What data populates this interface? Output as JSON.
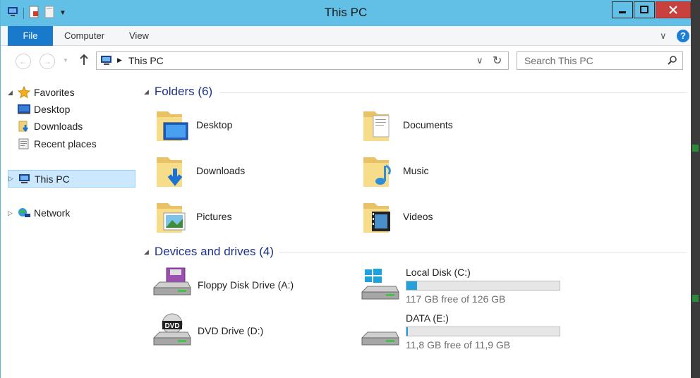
{
  "window": {
    "title": "This PC"
  },
  "ribbon": {
    "tabs": [
      "File",
      "Computer",
      "View"
    ]
  },
  "address": {
    "crumb": "This PC",
    "search_placeholder": "Search This PC"
  },
  "nav": {
    "favorites": "Favorites",
    "desktop": "Desktop",
    "downloads": "Downloads",
    "recent": "Recent places",
    "thispc": "This PC",
    "network": "Network"
  },
  "folders": {
    "heading": "Folders (6)",
    "items": [
      "Desktop",
      "Documents",
      "Downloads",
      "Music",
      "Pictures",
      "Videos"
    ]
  },
  "devices": {
    "heading": "Devices and drives (4)",
    "floppy": "Floppy Disk Drive (A:)",
    "dvd": "DVD Drive (D:)",
    "c": {
      "name": "Local Disk (C:)",
      "free": "117 GB free of 126 GB",
      "used_fraction": 0.071
    },
    "e": {
      "name": "DATA (E:)",
      "free": "11,8 GB free of 11,9 GB",
      "used_fraction": 0.008
    }
  }
}
